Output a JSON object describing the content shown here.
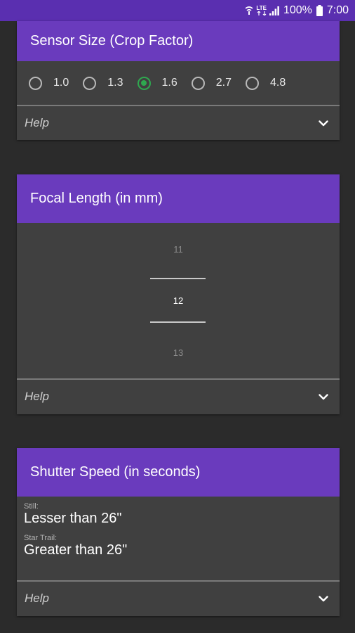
{
  "status_bar": {
    "lte": "LTE",
    "battery": "100%",
    "time": "7:00"
  },
  "sensor": {
    "title": "Sensor Size (Crop Factor)",
    "options": [
      "1.0",
      "1.3",
      "1.6",
      "2.7",
      "4.8"
    ],
    "selected": "1.6",
    "help": "Help"
  },
  "focal": {
    "title": "Focal Length (in mm)",
    "prev": "11",
    "current": "12",
    "next": "13",
    "help": "Help"
  },
  "shutter": {
    "title": "Shutter Speed (in seconds)",
    "still_label": "Still:",
    "still_value": "Lesser than 26\"",
    "star_label": "Star Trail:",
    "star_value": "Greater than 26\"",
    "help": "Help"
  },
  "colors": {
    "header": "#6a3bbd",
    "statusbar": "#5a2fb0",
    "card": "#404040",
    "background": "#2b2b2b",
    "selected_radio": "#2fa84f"
  }
}
